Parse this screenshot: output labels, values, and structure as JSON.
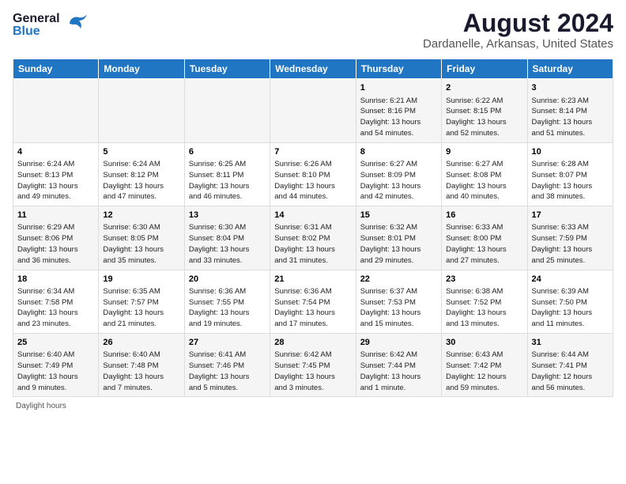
{
  "header": {
    "logo_general": "General",
    "logo_blue": "Blue",
    "main_title": "August 2024",
    "sub_title": "Dardanelle, Arkansas, United States"
  },
  "days_of_week": [
    "Sunday",
    "Monday",
    "Tuesday",
    "Wednesday",
    "Thursday",
    "Friday",
    "Saturday"
  ],
  "weeks": [
    [
      {
        "day": "",
        "info": ""
      },
      {
        "day": "",
        "info": ""
      },
      {
        "day": "",
        "info": ""
      },
      {
        "day": "",
        "info": ""
      },
      {
        "day": "1",
        "info": "Sunrise: 6:21 AM\nSunset: 8:16 PM\nDaylight: 13 hours\nand 54 minutes."
      },
      {
        "day": "2",
        "info": "Sunrise: 6:22 AM\nSunset: 8:15 PM\nDaylight: 13 hours\nand 52 minutes."
      },
      {
        "day": "3",
        "info": "Sunrise: 6:23 AM\nSunset: 8:14 PM\nDaylight: 13 hours\nand 51 minutes."
      }
    ],
    [
      {
        "day": "4",
        "info": "Sunrise: 6:24 AM\nSunset: 8:13 PM\nDaylight: 13 hours\nand 49 minutes."
      },
      {
        "day": "5",
        "info": "Sunrise: 6:24 AM\nSunset: 8:12 PM\nDaylight: 13 hours\nand 47 minutes."
      },
      {
        "day": "6",
        "info": "Sunrise: 6:25 AM\nSunset: 8:11 PM\nDaylight: 13 hours\nand 46 minutes."
      },
      {
        "day": "7",
        "info": "Sunrise: 6:26 AM\nSunset: 8:10 PM\nDaylight: 13 hours\nand 44 minutes."
      },
      {
        "day": "8",
        "info": "Sunrise: 6:27 AM\nSunset: 8:09 PM\nDaylight: 13 hours\nand 42 minutes."
      },
      {
        "day": "9",
        "info": "Sunrise: 6:27 AM\nSunset: 8:08 PM\nDaylight: 13 hours\nand 40 minutes."
      },
      {
        "day": "10",
        "info": "Sunrise: 6:28 AM\nSunset: 8:07 PM\nDaylight: 13 hours\nand 38 minutes."
      }
    ],
    [
      {
        "day": "11",
        "info": "Sunrise: 6:29 AM\nSunset: 8:06 PM\nDaylight: 13 hours\nand 36 minutes."
      },
      {
        "day": "12",
        "info": "Sunrise: 6:30 AM\nSunset: 8:05 PM\nDaylight: 13 hours\nand 35 minutes."
      },
      {
        "day": "13",
        "info": "Sunrise: 6:30 AM\nSunset: 8:04 PM\nDaylight: 13 hours\nand 33 minutes."
      },
      {
        "day": "14",
        "info": "Sunrise: 6:31 AM\nSunset: 8:02 PM\nDaylight: 13 hours\nand 31 minutes."
      },
      {
        "day": "15",
        "info": "Sunrise: 6:32 AM\nSunset: 8:01 PM\nDaylight: 13 hours\nand 29 minutes."
      },
      {
        "day": "16",
        "info": "Sunrise: 6:33 AM\nSunset: 8:00 PM\nDaylight: 13 hours\nand 27 minutes."
      },
      {
        "day": "17",
        "info": "Sunrise: 6:33 AM\nSunset: 7:59 PM\nDaylight: 13 hours\nand 25 minutes."
      }
    ],
    [
      {
        "day": "18",
        "info": "Sunrise: 6:34 AM\nSunset: 7:58 PM\nDaylight: 13 hours\nand 23 minutes."
      },
      {
        "day": "19",
        "info": "Sunrise: 6:35 AM\nSunset: 7:57 PM\nDaylight: 13 hours\nand 21 minutes."
      },
      {
        "day": "20",
        "info": "Sunrise: 6:36 AM\nSunset: 7:55 PM\nDaylight: 13 hours\nand 19 minutes."
      },
      {
        "day": "21",
        "info": "Sunrise: 6:36 AM\nSunset: 7:54 PM\nDaylight: 13 hours\nand 17 minutes."
      },
      {
        "day": "22",
        "info": "Sunrise: 6:37 AM\nSunset: 7:53 PM\nDaylight: 13 hours\nand 15 minutes."
      },
      {
        "day": "23",
        "info": "Sunrise: 6:38 AM\nSunset: 7:52 PM\nDaylight: 13 hours\nand 13 minutes."
      },
      {
        "day": "24",
        "info": "Sunrise: 6:39 AM\nSunset: 7:50 PM\nDaylight: 13 hours\nand 11 minutes."
      }
    ],
    [
      {
        "day": "25",
        "info": "Sunrise: 6:40 AM\nSunset: 7:49 PM\nDaylight: 13 hours\nand 9 minutes."
      },
      {
        "day": "26",
        "info": "Sunrise: 6:40 AM\nSunset: 7:48 PM\nDaylight: 13 hours\nand 7 minutes."
      },
      {
        "day": "27",
        "info": "Sunrise: 6:41 AM\nSunset: 7:46 PM\nDaylight: 13 hours\nand 5 minutes."
      },
      {
        "day": "28",
        "info": "Sunrise: 6:42 AM\nSunset: 7:45 PM\nDaylight: 13 hours\nand 3 minutes."
      },
      {
        "day": "29",
        "info": "Sunrise: 6:42 AM\nSunset: 7:44 PM\nDaylight: 13 hours\nand 1 minute."
      },
      {
        "day": "30",
        "info": "Sunrise: 6:43 AM\nSunset: 7:42 PM\nDaylight: 12 hours\nand 59 minutes."
      },
      {
        "day": "31",
        "info": "Sunrise: 6:44 AM\nSunset: 7:41 PM\nDaylight: 12 hours\nand 56 minutes."
      }
    ]
  ],
  "footer": {
    "label": "Daylight hours"
  }
}
